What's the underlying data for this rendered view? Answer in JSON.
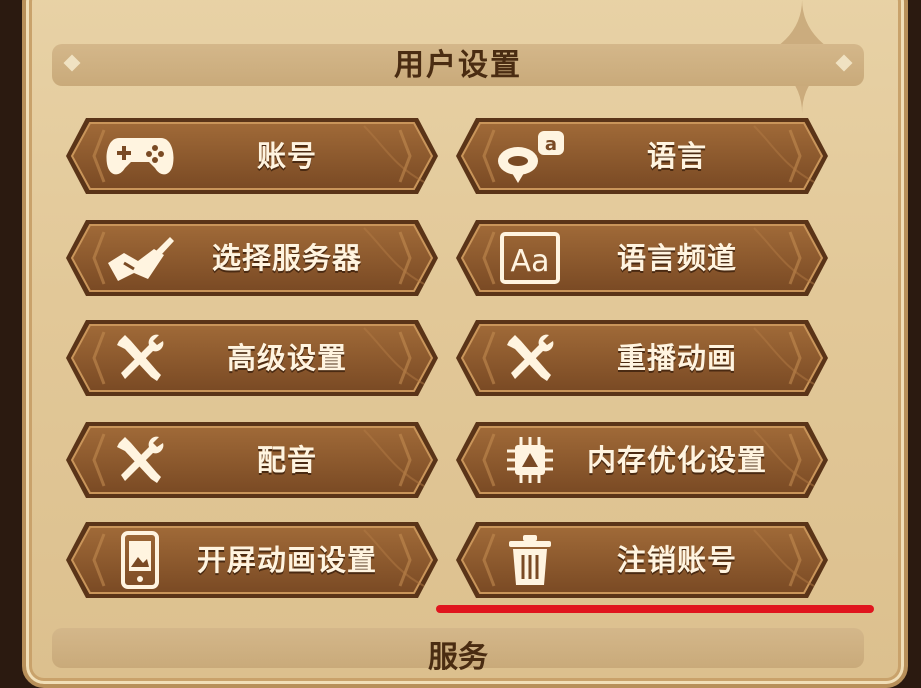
{
  "header": {
    "title": "用户设置"
  },
  "buttons": [
    {
      "label": "账号",
      "icon": "gamepad-icon"
    },
    {
      "label": "语言",
      "icon": "chat-bubbles-icon"
    },
    {
      "label": "选择服务器",
      "icon": "map-icon"
    },
    {
      "label": "语言频道",
      "icon": "font-aa-icon"
    },
    {
      "label": "高级设置",
      "icon": "wrench-screwdriver-icon"
    },
    {
      "label": "重播动画",
      "icon": "wrench-screwdriver-icon"
    },
    {
      "label": "配音",
      "icon": "wrench-screwdriver-icon"
    },
    {
      "label": "内存优化设置",
      "icon": "chip-icon"
    },
    {
      "label": "开屏动画设置",
      "icon": "phone-image-icon"
    },
    {
      "label": "注销账号",
      "icon": "trash-icon"
    }
  ],
  "next_section": {
    "title": "服务"
  },
  "colors": {
    "button_dark": "#7a4a24",
    "button_light": "#a06a38",
    "highlight": "#e0151e"
  }
}
